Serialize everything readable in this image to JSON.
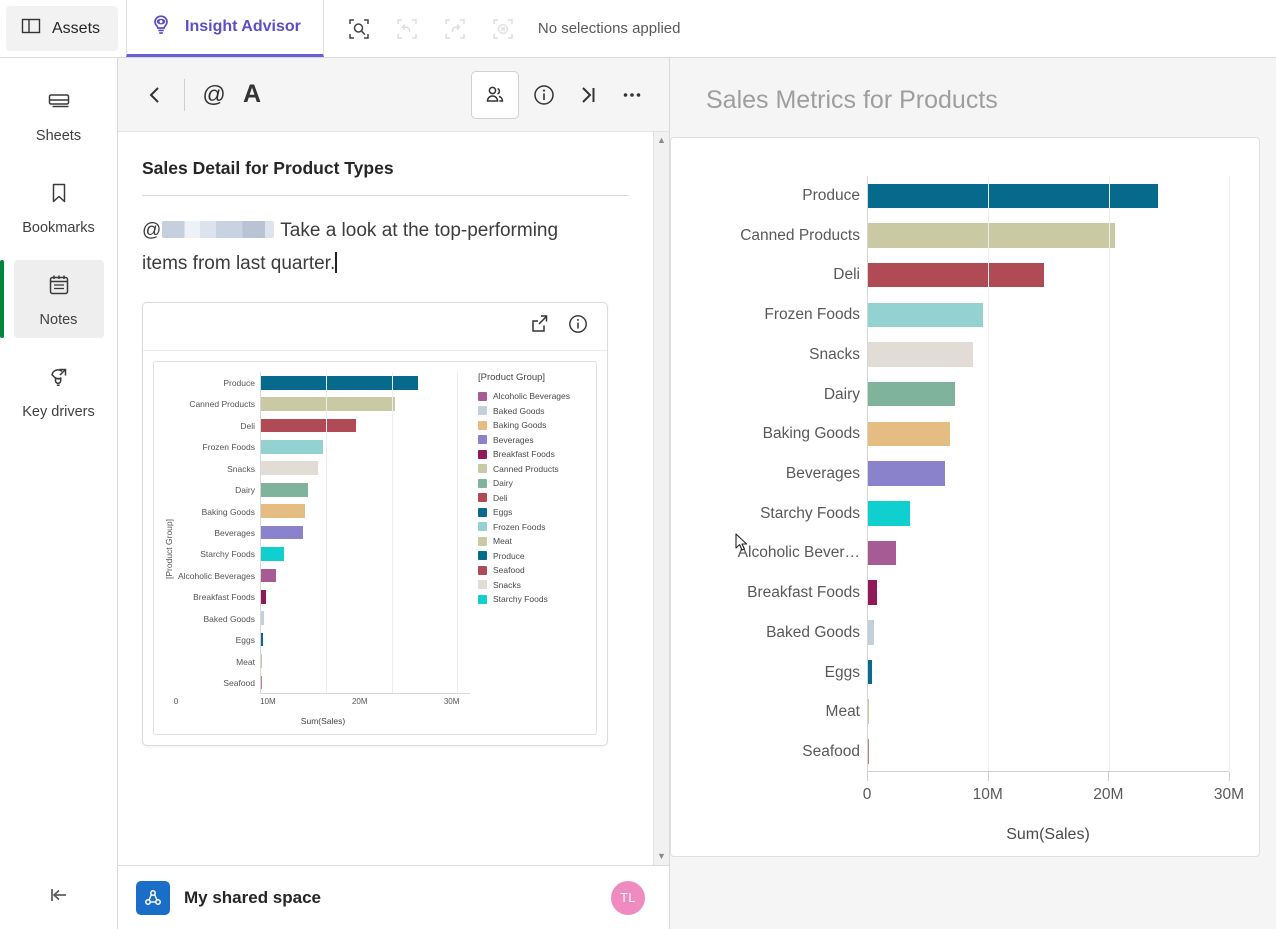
{
  "topbar": {
    "assets_label": "Assets",
    "assets_icon": "panel-layout-icon",
    "insight_advisor_label": "Insight Advisor",
    "insight_advisor_icon": "lightbulb-eye-icon",
    "selection_tools": [
      {
        "name": "selection-search-icon",
        "enabled": true
      },
      {
        "name": "selection-undo-icon",
        "enabled": false
      },
      {
        "name": "selection-redo-icon",
        "enabled": false
      },
      {
        "name": "selection-clear-icon",
        "enabled": false
      }
    ],
    "selections_status": "No selections applied"
  },
  "rail": {
    "items": [
      {
        "label": "Sheets",
        "icon": "sheets-icon",
        "active": false
      },
      {
        "label": "Bookmarks",
        "icon": "bookmark-icon",
        "active": false
      },
      {
        "label": "Notes",
        "icon": "notes-icon",
        "active": true
      },
      {
        "label": "Key drivers",
        "icon": "key-drivers-icon",
        "active": false
      }
    ],
    "collapse_icon": "collapse-left-icon",
    "active_accent": "#00873d"
  },
  "notes": {
    "toolbar": {
      "back_icon": "chevron-left-icon",
      "mention_icon": "at-sign-icon",
      "format_icon": "text-format-A-icon",
      "people_icon": "collaborators-icon",
      "info_icon": "info-icon",
      "expand_icon": "expand-right-icon",
      "more_icon": "more-ellipsis-icon"
    },
    "title": "Sales Detail for Product Types",
    "body_prefix": "@",
    "body_text": "Take a look at the top-performing items from last quarter.",
    "mention_redacted": true,
    "card": {
      "share_icon": "share-export-icon",
      "info_icon": "info-icon"
    },
    "scrollbar": {
      "up_icon": "scroll-up-arrow",
      "down_icon": "scroll-down-arrow"
    },
    "footer": {
      "space_icon": "shared-space-icon",
      "space_name": "My shared space",
      "avatar_initials": "TL",
      "avatar_color": "#f08bc0"
    }
  },
  "main": {
    "title": "Sales Metrics for Products"
  },
  "chart_data": [
    {
      "id": "main-chart",
      "type": "bar",
      "orientation": "horizontal",
      "title": "Sales Metrics for Products",
      "xlabel": "Sum(Sales)",
      "ylabel": "",
      "xlim": [
        0,
        30000000
      ],
      "xticks": [
        0,
        10000000,
        20000000,
        30000000
      ],
      "xticklabels": [
        "0",
        "10M",
        "20M",
        "30M"
      ],
      "grid": true,
      "legend": false,
      "categories": [
        "Produce",
        "Canned Products",
        "Deli",
        "Frozen Foods",
        "Snacks",
        "Dairy",
        "Baking Goods",
        "Beverages",
        "Starchy Foods",
        "Alcoholic Bever…",
        "Breakfast Foods",
        "Baked Goods",
        "Eggs",
        "Meat",
        "Seafood"
      ],
      "values": [
        24100000,
        20500000,
        14600000,
        9550000,
        8700000,
        7200000,
        6800000,
        6400000,
        3500000,
        2350000,
        760000,
        520000,
        300000,
        60000,
        40000
      ],
      "colors": [
        "#056a8c",
        "#c9c9a4",
        "#b04a55",
        "#93d2d1",
        "#e2dcd7",
        "#7fb39c",
        "#e5bd83",
        "#8b82cc",
        "#10cfcf",
        "#a65b94",
        "#8e1a59",
        "#c4cfdc",
        "#0a6a89",
        "#c9c9a4",
        "#c97c84"
      ]
    },
    {
      "id": "note-embedded-chart",
      "type": "bar",
      "orientation": "horizontal",
      "title": "",
      "xlabel": "Sum(Sales)",
      "ylabel": "[Product Group]",
      "xlim": [
        0,
        32000000
      ],
      "xticks": [
        0,
        10000000,
        20000000,
        30000000
      ],
      "xticklabels": [
        "0",
        "10M",
        "20M",
        "30M"
      ],
      "grid": true,
      "legend": true,
      "legend_title": "[Product Group]",
      "legend_position": "right",
      "categories": [
        "Produce",
        "Canned Products",
        "Deli",
        "Frozen Foods",
        "Snacks",
        "Dairy",
        "Baking Goods",
        "Beverages",
        "Starchy Foods",
        "Alcoholic Beverages",
        "Breakfast Foods",
        "Baked Goods",
        "Eggs",
        "Meat",
        "Seafood"
      ],
      "values": [
        24100000,
        20500000,
        14600000,
        9550000,
        8700000,
        7200000,
        6800000,
        6400000,
        3500000,
        2350000,
        760000,
        520000,
        300000,
        60000,
        40000
      ],
      "colors": [
        "#056a8c",
        "#c9c9a4",
        "#b04a55",
        "#93d2d1",
        "#e2dcd7",
        "#7fb39c",
        "#e5bd83",
        "#8b82cc",
        "#10cfcf",
        "#a65b94",
        "#8e1a59",
        "#c4cfdc",
        "#0a6a89",
        "#c9c9a4",
        "#c97c84"
      ],
      "legend_entries": [
        {
          "label": "Alcoholic Beverages",
          "color": "#a65b94"
        },
        {
          "label": "Baked Goods",
          "color": "#c4cfdc"
        },
        {
          "label": "Baking Goods",
          "color": "#e5bd83"
        },
        {
          "label": "Beverages",
          "color": "#8b82cc"
        },
        {
          "label": "Breakfast Foods",
          "color": "#8e1a59"
        },
        {
          "label": "Canned Products",
          "color": "#c9c9a4"
        },
        {
          "label": "Dairy",
          "color": "#7fb39c"
        },
        {
          "label": "Deli",
          "color": "#b04a55"
        },
        {
          "label": "Eggs",
          "color": "#0a6a89"
        },
        {
          "label": "Frozen Foods",
          "color": "#93d2d1"
        },
        {
          "label": "Meat",
          "color": "#c9c9a4"
        },
        {
          "label": "Produce",
          "color": "#056a8c"
        },
        {
          "label": "Seafood",
          "color": "#b04a55"
        },
        {
          "label": "Snacks",
          "color": "#e2dcd7"
        },
        {
          "label": "Starchy Foods",
          "color": "#10cfcf"
        }
      ]
    }
  ]
}
